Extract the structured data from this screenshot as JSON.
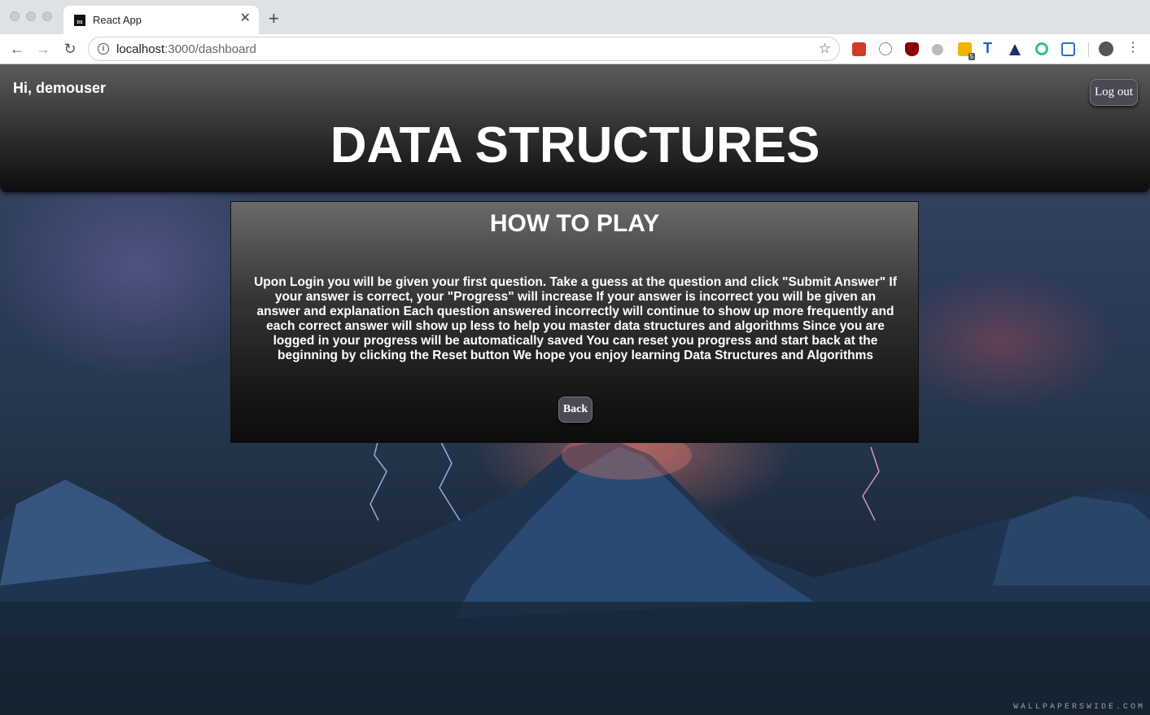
{
  "browser": {
    "tab_title": "React App",
    "favicon_text": "DS",
    "url_host": "localhost",
    "url_path": ":3000/dashboard",
    "extension_badge": "5"
  },
  "header": {
    "greeting": "Hi, demouser",
    "logout_label": "Log out",
    "title": "DATA STRUCTURES"
  },
  "how_to_play": {
    "title": "HOW TO PLAY",
    "body": "Upon Login you will be given your first question. Take a guess at the question and click \"Submit Answer\" If your answer is correct, your \"Progress\" will increase If your answer is incorrect you will be given an answer and explanation Each question answered incorrectly will continue to show up more frequently and each correct answer will show up less to help you master data structures and algorithms Since you are logged in your progress will be automatically saved You can reset you progress and start back at the beginning by clicking the Reset button We hope you enjoy learning Data Structures and Algorithms",
    "back_label": "Back"
  },
  "background": {
    "watermark": "WALLPAPERSWIDE.COM"
  },
  "colors": {
    "header_top": "#5c5c5c",
    "header_bottom": "#0e0e0e",
    "button_bg": "#4a4a56"
  }
}
